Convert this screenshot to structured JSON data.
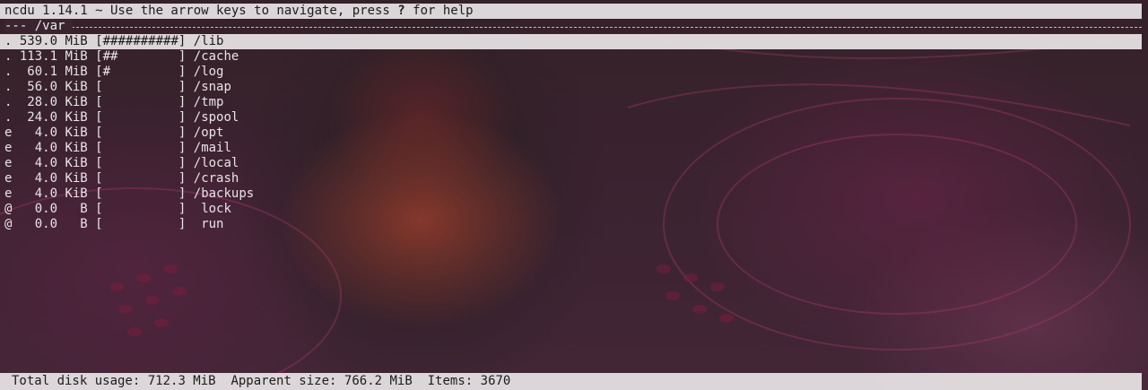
{
  "app": {
    "title_prefix": "ncdu 1.14.1 ~ Use the arrow keys to navigate, press ",
    "title_key": "?",
    "title_suffix": " for help"
  },
  "path": {
    "label": "--- /var "
  },
  "rows": [
    {
      "flag": ".",
      "size": "539.0 MiB",
      "bar": "[##########]",
      "name": "/lib"
    },
    {
      "flag": ".",
      "size": "113.1 MiB",
      "bar": "[##        ]",
      "name": "/cache"
    },
    {
      "flag": ".",
      "size": " 60.1 MiB",
      "bar": "[#         ]",
      "name": "/log"
    },
    {
      "flag": ".",
      "size": " 56.0 KiB",
      "bar": "[          ]",
      "name": "/snap"
    },
    {
      "flag": ".",
      "size": " 28.0 KiB",
      "bar": "[          ]",
      "name": "/tmp"
    },
    {
      "flag": ".",
      "size": " 24.0 KiB",
      "bar": "[          ]",
      "name": "/spool"
    },
    {
      "flag": "e",
      "size": "  4.0 KiB",
      "bar": "[          ]",
      "name": "/opt"
    },
    {
      "flag": "e",
      "size": "  4.0 KiB",
      "bar": "[          ]",
      "name": "/mail"
    },
    {
      "flag": "e",
      "size": "  4.0 KiB",
      "bar": "[          ]",
      "name": "/local"
    },
    {
      "flag": "e",
      "size": "  4.0 KiB",
      "bar": "[          ]",
      "name": "/crash"
    },
    {
      "flag": "e",
      "size": "  4.0 KiB",
      "bar": "[          ]",
      "name": "/backups"
    },
    {
      "flag": "@",
      "size": "  0.0   B",
      "bar": "[          ]",
      "name": " lock"
    },
    {
      "flag": "@",
      "size": "  0.0   B",
      "bar": "[          ]",
      "name": " run"
    }
  ],
  "status": {
    "total_label": "Total disk usage:",
    "total_value": "712.3 MiB",
    "apparent_label": "Apparent size:",
    "apparent_value": "766.2 MiB",
    "items_label": "Items:",
    "items_value": "3670"
  }
}
